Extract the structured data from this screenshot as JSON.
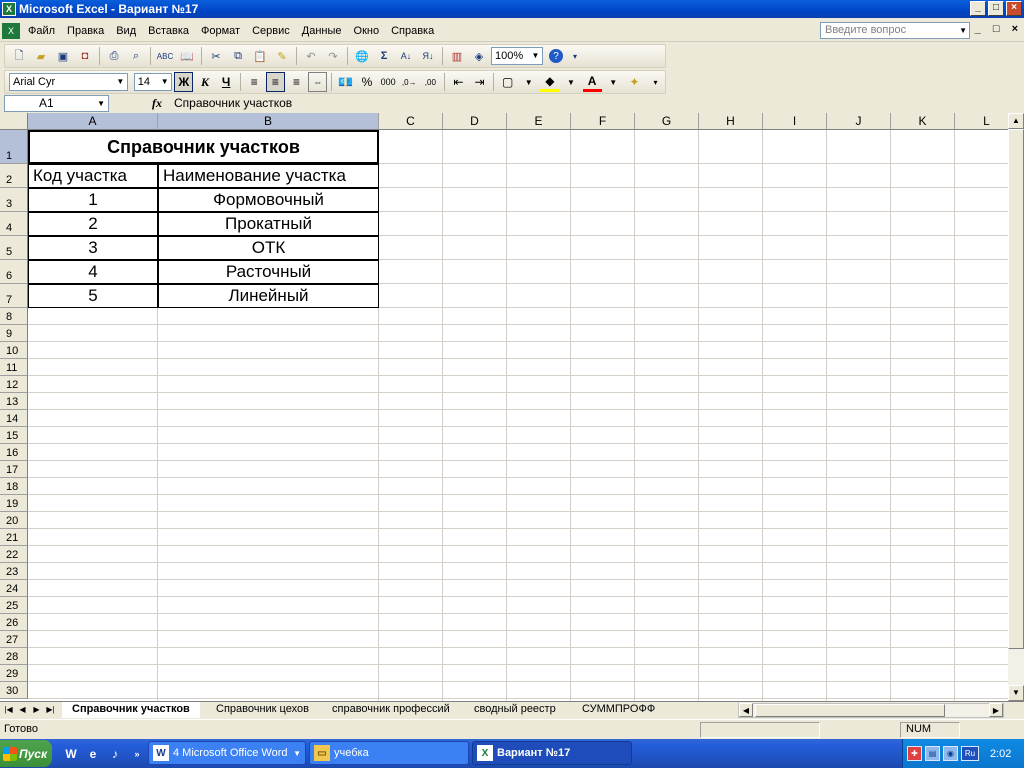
{
  "window": {
    "title": "Microsoft Excel - Вариант №17",
    "app_icon": "excel-icon",
    "controls": [
      "_",
      "□",
      "×"
    ],
    "doc_controls": [
      "_",
      "□",
      "×"
    ]
  },
  "menu": {
    "items": [
      "Файл",
      "Правка",
      "Вид",
      "Вставка",
      "Формат",
      "Сервис",
      "Данные",
      "Окно",
      "Справка"
    ],
    "ask_placeholder": "Введите вопрос"
  },
  "standard_toolbar": {
    "zoom": "100%",
    "icons": [
      "new-icon",
      "open-icon",
      "save-icon",
      "permission-icon",
      "print-icon",
      "print-preview-icon",
      "spelling-icon",
      "research-icon",
      "cut-icon",
      "copy-icon",
      "paste-icon",
      "format-painter-icon",
      "undo-icon",
      "redo-icon",
      "hyperlink-icon",
      "autosum-icon",
      "sort-ascending-icon",
      "sort-descending-icon",
      "chart-wizard-icon",
      "drawing-icon",
      "help-icon"
    ]
  },
  "format_toolbar": {
    "font": "Arial Cyr",
    "size": "14",
    "bold": "Ж",
    "italic": "К",
    "underline": "Ч",
    "percent": "%",
    "thousands": "000"
  },
  "formula_bar": {
    "name_box": "A1",
    "fx": "fx",
    "content": "Справочник участков"
  },
  "columns": [
    "A",
    "B",
    "C",
    "D",
    "E",
    "F",
    "G",
    "H",
    "I",
    "J",
    "K",
    "L"
  ],
  "rows": [
    "1",
    "2",
    "3",
    "4",
    "5",
    "6",
    "7",
    "8",
    "9",
    "10",
    "11",
    "12",
    "13",
    "14",
    "15",
    "16",
    "17",
    "18",
    "19",
    "20",
    "21",
    "22",
    "23",
    "24",
    "25",
    "26",
    "27",
    "28",
    "29",
    "30"
  ],
  "sheet": {
    "title": "Справочник участков",
    "headers": [
      "Код участка",
      "Наименование участка"
    ],
    "table": [
      [
        "1",
        "Формовочный"
      ],
      [
        "2",
        "Прокатный"
      ],
      [
        "3",
        "ОТК"
      ],
      [
        "4",
        "Расточный"
      ],
      [
        "5",
        "Линейный"
      ]
    ]
  },
  "tabs": [
    {
      "label": "Справочник участков",
      "active": true
    },
    {
      "label": "Справочник цехов",
      "active": false
    },
    {
      "label": "справочник профессий",
      "active": false
    },
    {
      "label": "сводный реестр",
      "active": false
    },
    {
      "label": "СУММПРОФФ",
      "active": false
    }
  ],
  "status": {
    "left": "Готово",
    "num": "NUM"
  },
  "taskbar": {
    "start": "Пуск",
    "tasks": [
      {
        "label": "4 Microsoft Office Word",
        "icon": "word-icon",
        "active": false
      },
      {
        "label": "учебка",
        "icon": "folder-icon",
        "active": false
      },
      {
        "label": "Вариант №17",
        "icon": "excel-icon",
        "active": true
      }
    ],
    "lang": "Ru",
    "clock": "2:02"
  }
}
